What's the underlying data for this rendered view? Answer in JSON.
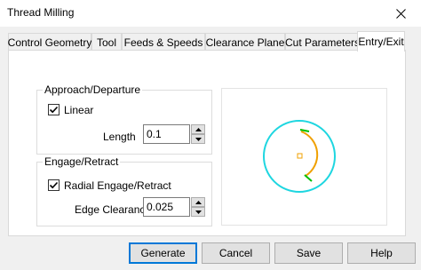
{
  "window": {
    "title": "Thread Milling"
  },
  "tabs": [
    {
      "label": "Control Geometry"
    },
    {
      "label": "Tool"
    },
    {
      "label": "Feeds & Speeds"
    },
    {
      "label": "Clearance Plane"
    },
    {
      "label": "Cut Parameters"
    },
    {
      "label": "Entry/Exit",
      "active": true
    }
  ],
  "approach": {
    "legend": "Approach/Departure",
    "linear_label": "Linear",
    "linear_checked": true,
    "length_label": "Length",
    "length_value": "0.1"
  },
  "engage": {
    "legend": "Engage/Retract",
    "radial_label": "Radial Engage/Retract",
    "radial_checked": true,
    "edge_label": "Edge Clearance",
    "edge_value": "0.025"
  },
  "buttons": {
    "generate": "Generate",
    "cancel": "Cancel",
    "save": "Save",
    "help": "Help"
  },
  "colors": {
    "circle": "#1ed6e0",
    "arc": "#f0a000",
    "ticks": "#00c000",
    "center": "#f0a000",
    "accent": "#0078d7"
  }
}
